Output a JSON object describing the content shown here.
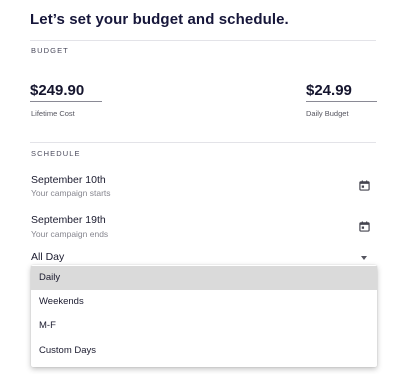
{
  "title": "Let’s set your budget and schedule.",
  "budget": {
    "section_label": "BUDGET",
    "lifetime": {
      "amount": "$249.90",
      "caption": "Lifetime Cost"
    },
    "daily": {
      "amount": "$24.99",
      "caption": "Daily Budget"
    }
  },
  "schedule": {
    "section_label": "SCHEDULE",
    "start": {
      "date": "September 10th",
      "caption": "Your campaign starts",
      "icon": "calendar-icon"
    },
    "end": {
      "date": "September 19th",
      "caption": "Your campaign ends",
      "icon": "calendar-icon"
    },
    "time_select": {
      "value": "All Day",
      "options": [
        "Daily",
        "Weekends",
        "M-F",
        "Custom Days"
      ],
      "highlighted": "Daily"
    }
  },
  "colors": {
    "highlight": "#dadada",
    "text": "#1a1a2e"
  }
}
